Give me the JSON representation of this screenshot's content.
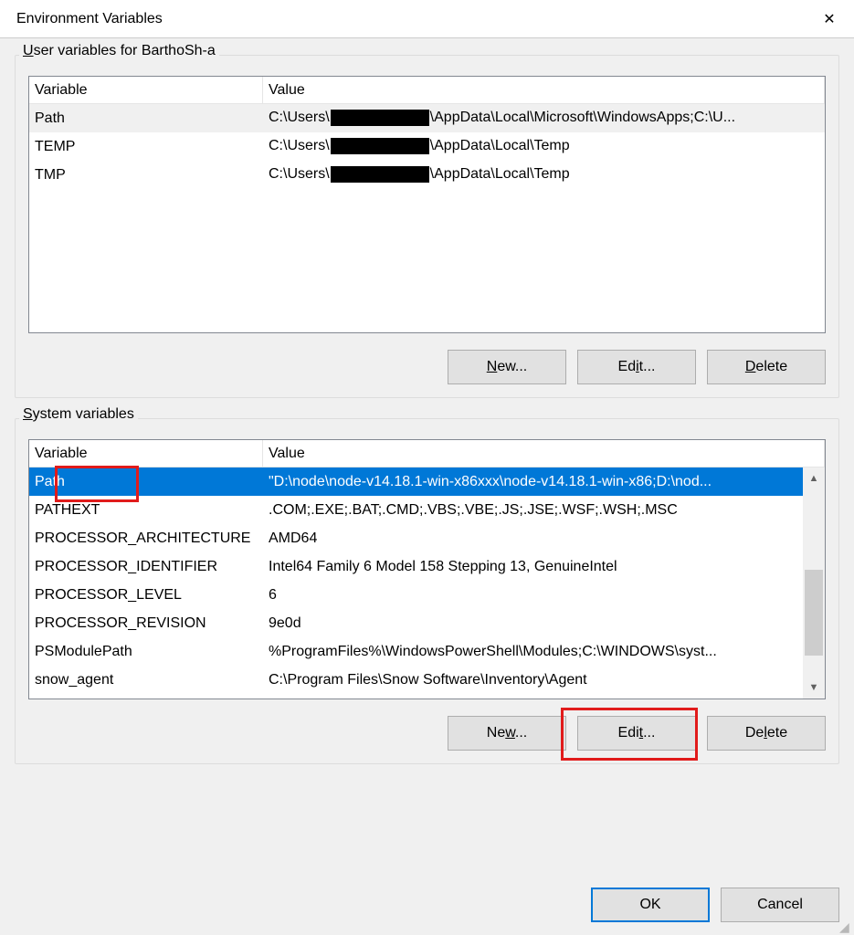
{
  "title": "Environment Variables",
  "user_section": {
    "label_prefix": "U",
    "label_rest": "ser variables for BarthoSh-a",
    "header_variable": "Variable",
    "header_value": "Value",
    "rows": [
      {
        "variable": "Path",
        "value_pre": "C:\\Users\\",
        "value_post": "\\AppData\\Local\\Microsoft\\WindowsApps;C:\\U...",
        "redacted": true,
        "selected": true
      },
      {
        "variable": "TEMP",
        "value_pre": "C:\\Users\\",
        "value_post": "\\AppData\\Local\\Temp",
        "redacted": true
      },
      {
        "variable": "TMP",
        "value_pre": "C:\\Users\\",
        "value_post": "\\AppData\\Local\\Temp",
        "redacted": true
      }
    ],
    "buttons": {
      "new_u": "N",
      "new_rest": "ew...",
      "edit_pre": "Ed",
      "edit_u": "i",
      "edit_post": "t...",
      "delete_u": "D",
      "delete_rest": "elete"
    }
  },
  "system_section": {
    "label_prefix": "S",
    "label_rest": "ystem variables",
    "header_variable": "Variable",
    "header_value": "Value",
    "rows": [
      {
        "variable": "Path",
        "value": "\"D:\\node\\node-v14.18.1-win-x86xxx\\node-v14.18.1-win-x86;D:\\nod...",
        "selected_blue": true
      },
      {
        "variable": "PATHEXT",
        "value": ".COM;.EXE;.BAT;.CMD;.VBS;.VBE;.JS;.JSE;.WSF;.WSH;.MSC"
      },
      {
        "variable": "PROCESSOR_ARCHITECTURE",
        "value": "AMD64"
      },
      {
        "variable": "PROCESSOR_IDENTIFIER",
        "value": "Intel64 Family 6 Model 158 Stepping 13, GenuineIntel"
      },
      {
        "variable": "PROCESSOR_LEVEL",
        "value": "6"
      },
      {
        "variable": "PROCESSOR_REVISION",
        "value": "9e0d"
      },
      {
        "variable": "PSModulePath",
        "value": "%ProgramFiles%\\WindowsPowerShell\\Modules;C:\\WINDOWS\\syst..."
      },
      {
        "variable": "snow_agent",
        "value": "C:\\Program Files\\Snow Software\\Inventory\\Agent"
      }
    ],
    "buttons": {
      "new_pre": "Ne",
      "new_u": "w",
      "new_post": "...",
      "edit_pre": "Edi",
      "edit_u": "t",
      "edit_post": "...",
      "delete_pre": "De",
      "delete_u": "l",
      "delete_post": "ete"
    }
  },
  "footer": {
    "ok": "OK",
    "cancel": "Cancel"
  },
  "glyphs": {
    "close": "✕",
    "up": "▲",
    "down": "▼",
    "grip": "◢"
  }
}
